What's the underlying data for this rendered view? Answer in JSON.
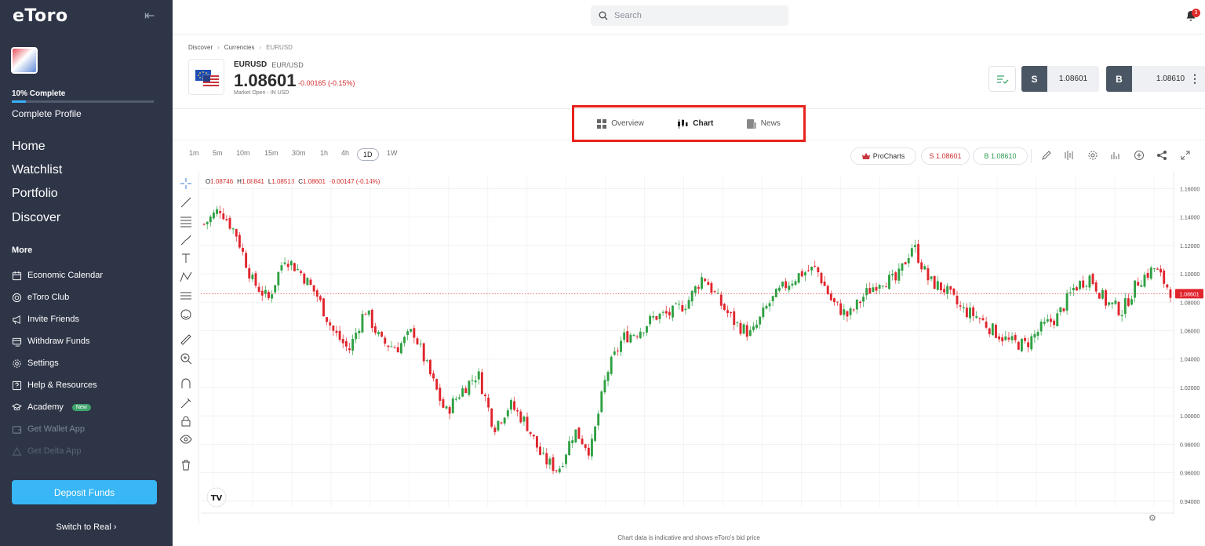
{
  "sidebar": {
    "logo": "eToro",
    "progress_label": "10% Complete",
    "progress_value": 0.1,
    "progress_sub": "Complete Profile",
    "nav": [
      "Home",
      "Watchlist",
      "Portfolio",
      "Discover"
    ],
    "more_label": "More",
    "menu": [
      {
        "label": "Economic Calendar",
        "icon": "calendar-icon"
      },
      {
        "label": "eToro Club",
        "icon": "club-icon"
      },
      {
        "label": "Invite Friends",
        "icon": "megaphone-icon"
      },
      {
        "label": "Withdraw Funds",
        "icon": "withdraw-icon"
      },
      {
        "label": "Settings",
        "icon": "gear-icon"
      },
      {
        "label": "Help & Resources",
        "icon": "help-icon"
      },
      {
        "label": "Academy",
        "icon": "academy-icon",
        "badge": "New"
      },
      {
        "label": "Get Wallet App",
        "icon": "wallet-icon"
      },
      {
        "label": "Get Delta App",
        "icon": "delta-icon"
      }
    ],
    "deposit": "Deposit Funds",
    "switch": "Switch to Real ›"
  },
  "topbar": {
    "search_placeholder": "Search",
    "notifications": "3"
  },
  "breadcrumb": [
    "Discover",
    "Currencies",
    "EURUSD"
  ],
  "instrument": {
    "symbol": "EURUSD",
    "name": "EUR/USD",
    "price": "1.08601",
    "change": "-0.00165 (-0.15%)",
    "status": "Market Open",
    "currency": "IN USD",
    "sell_label": "S",
    "sell_price": "1.08601",
    "buy_label": "B",
    "buy_price": "1.08610"
  },
  "tabs": [
    {
      "label": "Overview",
      "icon": "grid-icon"
    },
    {
      "label": "Chart",
      "icon": "candles-icon",
      "active": true
    },
    {
      "label": "News",
      "icon": "news-icon"
    }
  ],
  "timeframes": [
    "1m",
    "5m",
    "10m",
    "15m",
    "30m",
    "1h",
    "4h",
    "1D",
    "1W"
  ],
  "selected_timeframe": "1D",
  "chart_toolbar": {
    "procharts": "ProCharts",
    "sell": "S 1.08601",
    "buy": "B 1.08610"
  },
  "ohlc": {
    "o_label": "O",
    "o": "1.08746",
    "h_label": "H",
    "h": "1.08841",
    "l_label": "L",
    "l": "1.08513",
    "c_label": "C",
    "c": "1.08601",
    "chg": "-0.00147 (-0.14%)"
  },
  "chart_data": {
    "type": "candlestick",
    "yticks": [
      "1.16000",
      "1.14000",
      "1.12000",
      "1.10000",
      "1.08000",
      "1.06000",
      "1.04000",
      "1.02000",
      "1.00000",
      "0.98000",
      "0.96000",
      "0.94000"
    ],
    "xticks": [
      "Feb",
      "2",
      "Apr",
      "3",
      "Jun",
      "Jul",
      "Aug",
      "Sep",
      "Oct",
      "Nov",
      "Dec",
      "2023",
      "Feb",
      "2",
      "Apr",
      "2",
      "Jun",
      "Jul",
      "Aug",
      "Sep",
      "Oct",
      "Nov",
      "30",
      "2024",
      "2'"
    ],
    "bold_xticks": [
      "2023",
      "2024"
    ],
    "current_price": "1.08601",
    "ylim": [
      0.936,
      1.168
    ],
    "path": [
      1.135,
      1.146,
      1.128,
      1.095,
      1.082,
      1.112,
      1.101,
      1.085,
      1.06,
      1.046,
      1.075,
      1.052,
      1.048,
      1.06,
      1.03,
      1.002,
      1.018,
      1.03,
      0.992,
      1.008,
      0.995,
      0.97,
      0.962,
      0.99,
      0.975,
      1.03,
      1.055,
      1.06,
      1.07,
      1.072,
      1.08,
      1.099,
      1.08,
      1.065,
      1.057,
      1.078,
      1.091,
      1.1,
      1.104,
      1.08,
      1.07,
      1.085,
      1.096,
      1.095,
      1.121,
      1.095,
      1.089,
      1.075,
      1.07,
      1.06,
      1.052,
      1.05,
      1.062,
      1.07,
      1.09,
      1.098,
      1.08,
      1.074,
      1.095,
      1.104,
      1.088
    ]
  },
  "footer": "Chart data is indicative and shows eToro's bid price"
}
